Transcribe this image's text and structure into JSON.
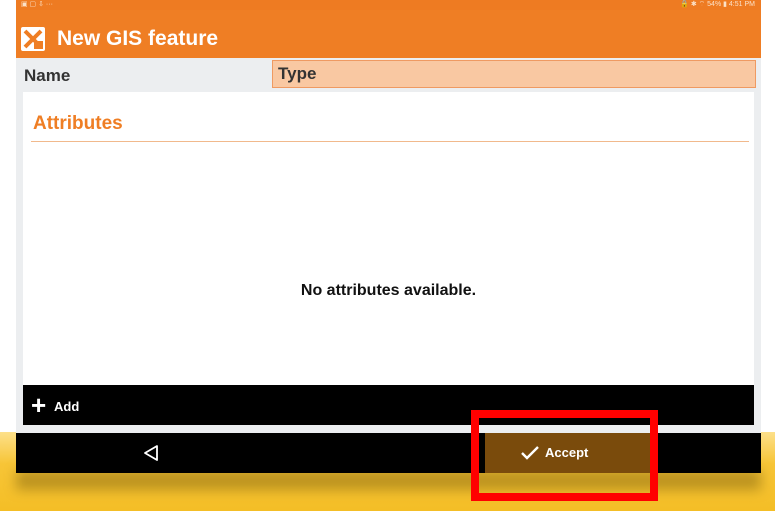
{
  "status_bar": {
    "left_icons": "▣ ▢ ⇩ ···",
    "right_info": "🔒 ✱ ⌔ 54% ▮ 4:51 PM"
  },
  "app_bar": {
    "title": "New GIS feature",
    "logo_icon": "app-logo-icon"
  },
  "header": {
    "name_label": "Name",
    "type_label": "Type"
  },
  "attributes": {
    "section_title": "Attributes",
    "empty_message": "No attributes available."
  },
  "actions": {
    "add_plus": "+",
    "add_label": "Add",
    "accept_label": "Accept"
  },
  "colors": {
    "accent": "#ef7e24",
    "type_field": "#f9c8a2",
    "accept_bg": "#7a4b0c",
    "highlight": "#ff0000"
  }
}
